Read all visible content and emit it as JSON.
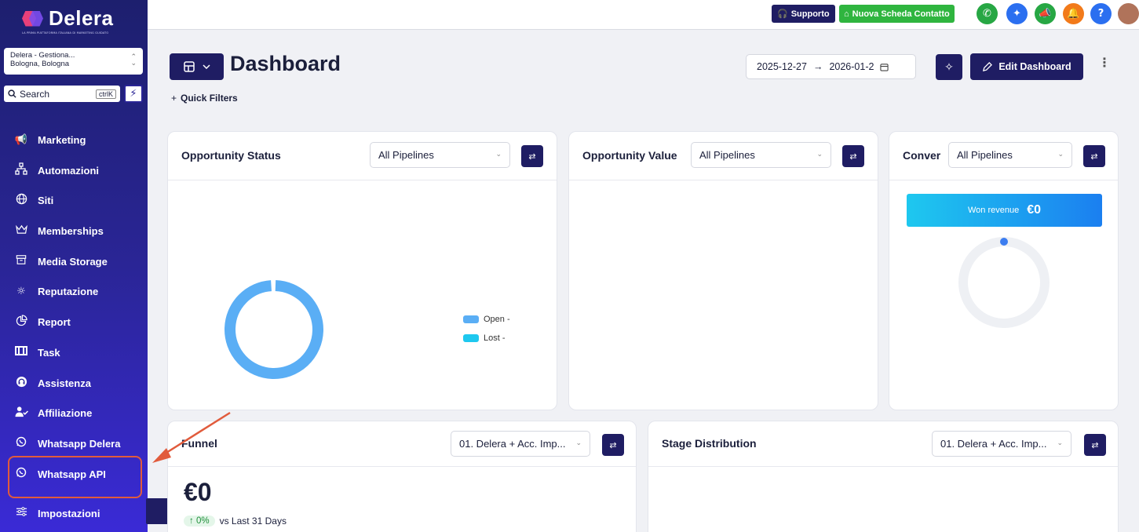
{
  "brand": {
    "name": "Delera",
    "tagline": "LA PRIMA PIATTAFORMA ITALIANA DI MARKETING GUIDATO"
  },
  "location": {
    "line1": "Delera - Gestiona...",
    "line2": "Bologna, Bologna"
  },
  "search": {
    "label": "Search",
    "shortcut": "ctrlK"
  },
  "sidebar": {
    "items": [
      {
        "label": "Marketing",
        "icon": "megaphone-icon"
      },
      {
        "label": "Automazioni",
        "icon": "workflow-icon"
      },
      {
        "label": "Siti",
        "icon": "globe-icon"
      },
      {
        "label": "Memberships",
        "icon": "crown-icon"
      },
      {
        "label": "Media Storage",
        "icon": "archive-icon"
      },
      {
        "label": "Reputazione",
        "icon": "star-burst-icon"
      },
      {
        "label": "Report",
        "icon": "pie-chart-icon"
      },
      {
        "label": "Task",
        "icon": "task-icon"
      },
      {
        "label": "Assistenza",
        "icon": "headset-icon"
      },
      {
        "label": "Affiliazione",
        "icon": "user-check-icon"
      },
      {
        "label": "Whatsapp Delera",
        "icon": "whatsapp-icon"
      },
      {
        "label": "Whatsapp API",
        "icon": "whatsapp-icon"
      },
      {
        "label": "Impostazioni",
        "icon": "settings-sliders-icon"
      }
    ]
  },
  "topbar": {
    "support_label": "Supporto",
    "new_contact_label": "Nuova Scheda Contatto",
    "colors": {
      "support": "#1f1d63",
      "new_contact": "#2fb53f"
    }
  },
  "header": {
    "title": "Dashboard",
    "quick_filters": "Quick Filters",
    "date_start": "2025-12-27",
    "date_end": "2026-01-2",
    "edit_label": "Edit Dashboard"
  },
  "widgets": {
    "opportunity_status": {
      "title": "Opportunity Status",
      "select": "All Pipelines",
      "legend": [
        {
          "label": "Open -",
          "color": "#5aaef5"
        },
        {
          "label": "Lost -",
          "color": "#1ec8ef"
        }
      ]
    },
    "opportunity_value": {
      "title": "Opportunity Value",
      "select": "All Pipelines"
    },
    "conversion": {
      "title": "Conver",
      "select": "All Pipelines",
      "won_label": "Won revenue",
      "won_value": "€0"
    },
    "funnel": {
      "title": "Funnel",
      "select": "01. Delera + Acc. Imp...",
      "value": "€0",
      "change": "0%",
      "comparison": "vs Last 31 Days"
    },
    "stage_distribution": {
      "title": "Stage Distribution",
      "select": "01. Delera + Acc. Imp..."
    }
  }
}
